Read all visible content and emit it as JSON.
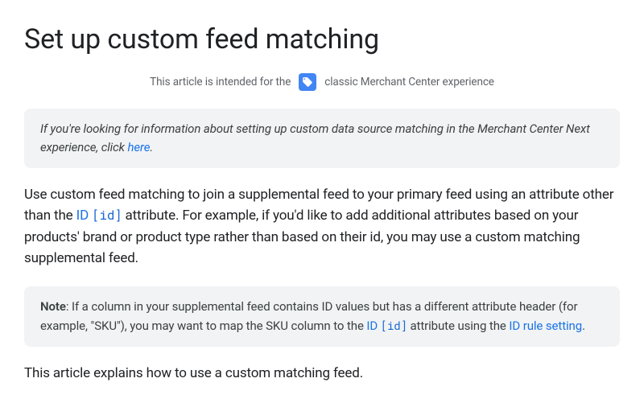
{
  "pageTitle": "Set up custom feed matching",
  "intendedFor": {
    "prefix": "This article is intended for the",
    "suffix": "classic Merchant Center experience"
  },
  "noticeBox": {
    "text": "If you're looking for information about setting up custom data source matching in the Merchant Center Next experience, click ",
    "linkLabel": "here",
    "period": "."
  },
  "intro": {
    "part1": "Use custom feed matching to join a supplemental feed to your primary feed using an attribute other than the ",
    "idLink": "ID",
    "idCode": "[id]",
    "part2": " attribute. For example, if you'd like to add additional attributes based on your products' brand or product type rather than based on their id, you may use a custom matching supplemental feed."
  },
  "noteBox": {
    "label": "Note",
    "text1": ": If a column in your supplemental feed contains ID values but has a different attribute header (for example, \"SKU\"), you may want to map the SKU column to the ",
    "idLink": "ID",
    "idCode": "[id]",
    "text2": " attribute using the ",
    "ruleLink": "ID rule setting",
    "period": "."
  },
  "outro": "This article explains how to use a custom matching feed."
}
